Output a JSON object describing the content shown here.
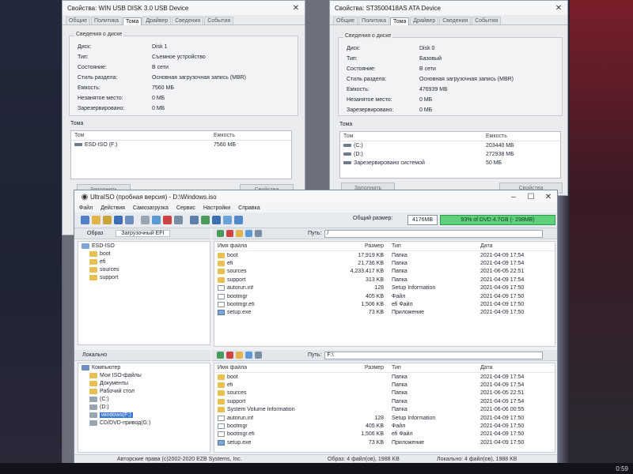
{
  "usb_window": {
    "title": "Свойства: WIN USB DISK 3.0 USB Device",
    "tabs": [
      "Общие",
      "Политика",
      "Тома",
      "Драйвер",
      "Сведения",
      "События"
    ],
    "group_title": "Сведения о диске",
    "fields": [
      {
        "label": "Диск:",
        "value": "Disk 1"
      },
      {
        "label": "Тип:",
        "value": "Съемное устройство"
      },
      {
        "label": "Состояние:",
        "value": "В сети"
      },
      {
        "label": "Стиль раздела:",
        "value": "Основная загрузочная запись (MBR)"
      },
      {
        "label": "Емкость:",
        "value": "7560 МБ"
      },
      {
        "label": "Незанятое место:",
        "value": "0 МБ"
      },
      {
        "label": "Зарезервировано:",
        "value": "0 МБ"
      }
    ],
    "volumes_title": "Тома",
    "col_volume": "Том",
    "col_capacity": "Емкость",
    "volumes": [
      {
        "name": "ESD-ISO (F:)",
        "capacity": "7560 МБ"
      }
    ],
    "btn_fill": "Заполнить",
    "btn_props": "Свойства"
  },
  "ata_window": {
    "title": "Свойства: ST3500418AS ATA Device",
    "tabs": [
      "Общие",
      "Политика",
      "Тома",
      "Драйвер",
      "Сведения",
      "События"
    ],
    "group_title": "Сведения о диске",
    "fields": [
      {
        "label": "Диск:",
        "value": "Disk 0"
      },
      {
        "label": "Тип:",
        "value": "Базовый"
      },
      {
        "label": "Состояние:",
        "value": "В сети"
      },
      {
        "label": "Стиль раздела:",
        "value": "Основная загрузочная запись (MBR)"
      },
      {
        "label": "Емкость:",
        "value": "476939 МБ"
      },
      {
        "label": "Незанятое место:",
        "value": "0 МБ"
      },
      {
        "label": "Зарезервировано:",
        "value": "0 МБ"
      }
    ],
    "volumes_title": "Тома",
    "col_volume": "Том",
    "col_capacity": "Емкость",
    "volumes": [
      {
        "name": "(C:)",
        "capacity": "203440 МБ"
      },
      {
        "name": "(D:)",
        "capacity": "272938 МБ"
      },
      {
        "name": "Зарезервировано системой",
        "capacity": "50 МБ"
      }
    ],
    "btn_fill": "Заполнить",
    "btn_props": "Свойства"
  },
  "ultraiso": {
    "title": "UltraISO (пробная версия) - D:\\Windows.iso",
    "menu": [
      "Файл",
      "Действия",
      "Самозагрузка",
      "Сервис",
      "Настройки",
      "Справка"
    ],
    "total_size_label": "Общий размер:",
    "total_size_value": "4176MB",
    "capacity_text": "93% of DVD 4.7GB (- 298MB)",
    "capacity_fraction": 0.93,
    "image_tab": "Образ",
    "boot_tab": "Загрузочный EFI",
    "path_label": "Путь:",
    "image_path": "/",
    "local_path": "F:\\",
    "image_tree": [
      {
        "label": "ESD-ISO",
        "level": 0
      },
      {
        "label": "boot",
        "level": 1
      },
      {
        "label": "efi",
        "level": 1
      },
      {
        "label": "sources",
        "level": 1
      },
      {
        "label": "support",
        "level": 1
      }
    ],
    "columns": {
      "name": "Имя файла",
      "size": "Размер",
      "type": "Тип",
      "date": "Дата"
    },
    "image_files": [
      {
        "name": "boot",
        "size": "17,919 KB",
        "type": "Папка",
        "date": "2021-04-09 17:54",
        "icon": "folder"
      },
      {
        "name": "efi",
        "size": "21,736 KB",
        "type": "Папка",
        "date": "2021-04-09 17:54",
        "icon": "folder"
      },
      {
        "name": "sources",
        "size": "4,233,417 KB",
        "type": "Папка",
        "date": "2021-06-05 22:51",
        "icon": "folder"
      },
      {
        "name": "support",
        "size": "313 KB",
        "type": "Папка",
        "date": "2021-04-09 17:54",
        "icon": "folder"
      },
      {
        "name": "autorun.inf",
        "size": "128",
        "type": "Setup Information",
        "date": "2021-04-09 17:50",
        "icon": "file"
      },
      {
        "name": "bootmgr",
        "size": "405 KB",
        "type": "Файл",
        "date": "2021-04-09 17:50",
        "icon": "file"
      },
      {
        "name": "bootmgr.efi",
        "size": "1,506 KB",
        "type": "efi Файл",
        "date": "2021-04-09 17:50",
        "icon": "file"
      },
      {
        "name": "setup.exe",
        "size": "73 KB",
        "type": "Приложение",
        "date": "2021-04-09 17:50",
        "icon": "exe"
      }
    ],
    "local_title": "Локально",
    "local_tree": [
      {
        "label": "Компьютер",
        "level": 0
      },
      {
        "label": "Мои ISO-файлы",
        "level": 1
      },
      {
        "label": "Документы",
        "level": 1
      },
      {
        "label": "Рабочий стол",
        "level": 1
      },
      {
        "label": "(C:)",
        "level": 1
      },
      {
        "label": "(D:)",
        "level": 1
      },
      {
        "label": "windows(F:)",
        "level": 1
      },
      {
        "label": "CD/DVD-привод(G:)",
        "level": 1
      }
    ],
    "local_files": [
      {
        "name": "boot",
        "size": "",
        "type": "Папка",
        "date": "2021-04-09 17:54",
        "icon": "folder"
      },
      {
        "name": "efi",
        "size": "",
        "type": "Папка",
        "date": "2021-04-09 17:54",
        "icon": "folder"
      },
      {
        "name": "sources",
        "size": "",
        "type": "Папка",
        "date": "2021-06-05 22:51",
        "icon": "folder"
      },
      {
        "name": "support",
        "size": "",
        "type": "Папка",
        "date": "2021-04-09 17:54",
        "icon": "folder"
      },
      {
        "name": "System Volume Information",
        "size": "",
        "type": "Папка",
        "date": "2021-06-06 00:55",
        "icon": "folder"
      },
      {
        "name": "autorun.inf",
        "size": "128",
        "type": "Setup Information",
        "date": "2021-04-09 17:50",
        "icon": "file"
      },
      {
        "name": "bootmgr",
        "size": "405 KB",
        "type": "Файл",
        "date": "2021-04-09 17:50",
        "icon": "file"
      },
      {
        "name": "bootmgr.efi",
        "size": "1,506 KB",
        "type": "efi Файл",
        "date": "2021-04-09 17:50",
        "icon": "file"
      },
      {
        "name": "setup.exe",
        "size": "73 KB",
        "type": "Приложение",
        "date": "2021-04-09 17:50",
        "icon": "exe"
      }
    ],
    "status_copyright": "Авторские права (c)2002-2020 EZB Systems, Inc.",
    "status_image": "Образ: 4 файл(ов), 1988 KB",
    "status_local": "Локально: 4 файл(ов), 1988 KB"
  },
  "taskbar": {
    "clock": "0:59"
  }
}
